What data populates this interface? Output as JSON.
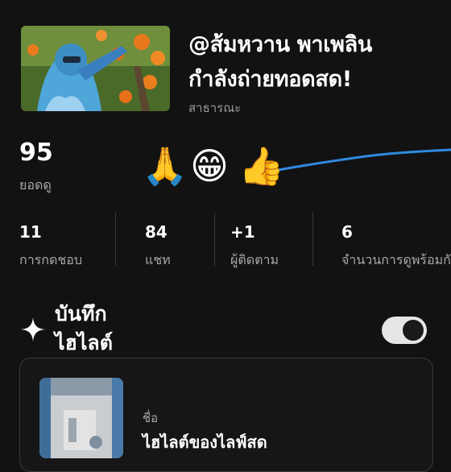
{
  "stream": {
    "title_line1": "@ส้มหวาน พาเพลิน",
    "title_line2": "กำลังถ่ายทอดสด!",
    "privacy": "สาธารณะ"
  },
  "views": {
    "count": "95",
    "label": "ยอดดู"
  },
  "reactions": [
    "🙏",
    "😁",
    "👍"
  ],
  "stats": [
    {
      "value": "11",
      "label": "การกดชอบ"
    },
    {
      "value": "84",
      "label": "แชท"
    },
    {
      "value": "+1",
      "label": "ผู้ติดตาม"
    },
    {
      "value": "6",
      "label": "จำนวนการดูพร้อมกันสูงสุด"
    }
  ],
  "highlight": {
    "title_line1": "บันทึก",
    "title_line2": "ไฮไลต์",
    "toggle_on": true,
    "name_label": "ชื่อ",
    "name_value": "ไฮไลต์ของไลฟ์สด"
  },
  "colors": {
    "background": "#121212",
    "graph_line": "#2f8ae0",
    "toggle_track": "#e6e6e6"
  }
}
